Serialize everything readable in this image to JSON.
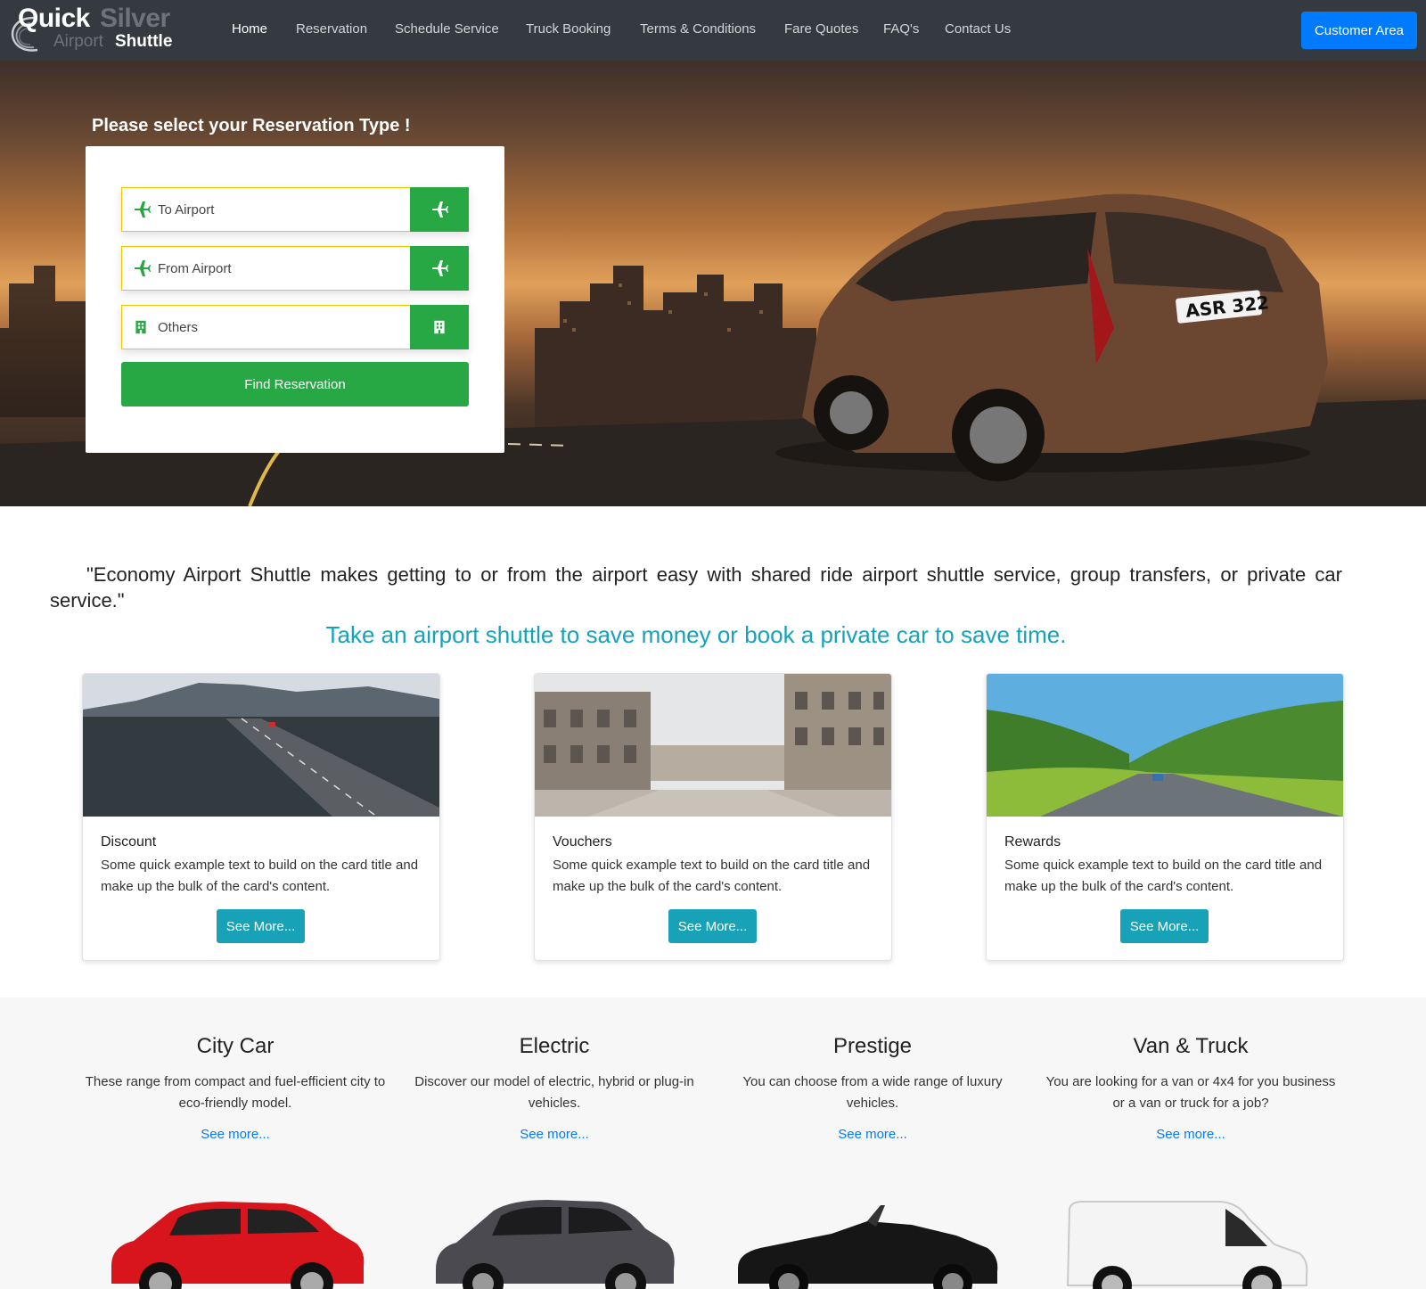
{
  "brand": {
    "word1": "Quick",
    "word2": "Silver",
    "word3": "Airport",
    "word4": "Shuttle"
  },
  "nav": {
    "items": [
      {
        "label": "Home",
        "active": true
      },
      {
        "label": "Reservation"
      },
      {
        "label": "Schedule Service"
      },
      {
        "label": "Truck Booking"
      },
      {
        "label": "Terms & Conditions"
      },
      {
        "label": "Fare Quotes"
      },
      {
        "label": "FAQ's"
      },
      {
        "label": "Contact Us"
      }
    ],
    "customer_area": "Customer Area"
  },
  "hero": {
    "title": "Please select your Reservation Type !",
    "options": [
      {
        "label": "To Airport",
        "icon": "plane-icon"
      },
      {
        "label": "From Airport",
        "icon": "plane-icon"
      },
      {
        "label": "Others",
        "icon": "building-icon"
      }
    ],
    "find_button": "Find Reservation",
    "plate": "ASR 322"
  },
  "intro": {
    "quote": "\"Economy Airport Shuttle makes getting to or from the airport easy with shared ride airport shuttle service, group transfers, or private car service.\"",
    "tagline": "Take an airport shuttle to save money or book a private car to save time."
  },
  "cards": [
    {
      "title": "Discount",
      "text": "Some quick example text to build on the card title and make up the bulk of the card's content.",
      "button": "See More..."
    },
    {
      "title": "Vouchers",
      "text": "Some quick example text to build on the card title and make up the bulk of the card's content.",
      "button": "See More..."
    },
    {
      "title": "Rewards",
      "text": "Some quick example text to build on the card title and make up the bulk of the card's content.",
      "button": "See More..."
    }
  ],
  "categories": [
    {
      "title": "City Car",
      "text": "These range from compact and fuel-efficient city to eco-friendly model.",
      "link": "See more..."
    },
    {
      "title": "Electric",
      "text": "Discover our model of electric, hybrid or plug-in vehicles.",
      "link": "See more..."
    },
    {
      "title": "Prestige",
      "text": "You can choose from a wide range of luxury vehicles.",
      "link": "See more..."
    },
    {
      "title": "Van & Truck",
      "text": "You are looking for a van or 4x4 for you business or a van or truck for a job?",
      "link": "See more..."
    }
  ],
  "colors": {
    "navbar": "#343a40",
    "primary": "#007bff",
    "success": "#28a745",
    "info": "#17a2b8",
    "field_border": "#f5c400"
  }
}
